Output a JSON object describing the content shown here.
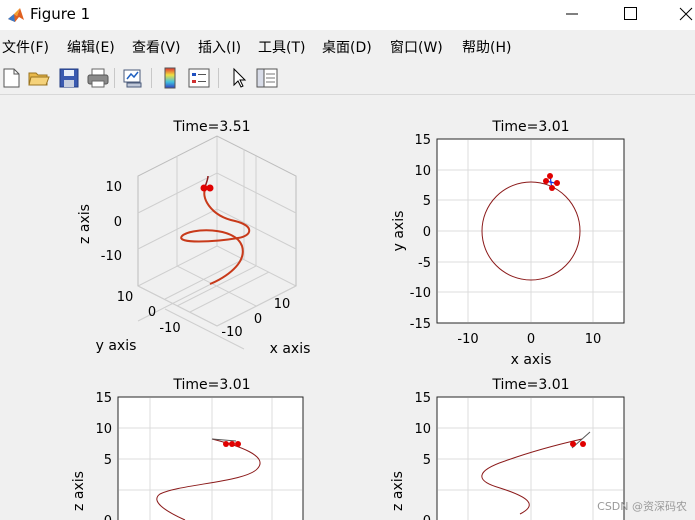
{
  "window": {
    "title": "Figure 1"
  },
  "menu": [
    "文件(F)",
    "编辑(E)",
    "查看(V)",
    "插入(I)",
    "工具(T)",
    "桌面(D)",
    "窗口(W)",
    "帮助(H)"
  ],
  "toolbar": [
    "new-figure-icon",
    "open-file-icon",
    "save-icon",
    "print-icon",
    "link-plot-icon",
    "colorbar-icon",
    "legend-icon",
    "pointer-icon",
    "plot-tools-icon"
  ],
  "colors": {
    "trajectory": "#8b1a1a",
    "marker": "#e00000",
    "mirror": "#1030e0",
    "grid": "#dcdcdc"
  },
  "plots": {
    "p1": {
      "title": "Time=3.51",
      "xlabel": "x axis",
      "ylabel": "y axis",
      "zlabel": "z axis",
      "zticks": [
        "10",
        "0",
        "-10"
      ],
      "yticks": [
        "10",
        "0",
        "-10"
      ],
      "xticks": [
        "-10",
        "0",
        "10"
      ]
    },
    "p2": {
      "title": "Time=3.01",
      "xlabel": "x axis",
      "ylabel": "y axis",
      "xticks": [
        "-10",
        "0",
        "10"
      ],
      "yticks": [
        "15",
        "10",
        "5",
        "0",
        "-5",
        "-10",
        "-15"
      ]
    },
    "p3": {
      "title": "Time=3.01",
      "ylabel": "z axis",
      "yticks": [
        "15",
        "10",
        "5",
        "0"
      ]
    },
    "p4": {
      "title": "Time=3.01",
      "ylabel": "z axis",
      "yticks": [
        "15",
        "10",
        "5",
        "0"
      ]
    }
  },
  "watermark": "CSDN @资深码农"
}
